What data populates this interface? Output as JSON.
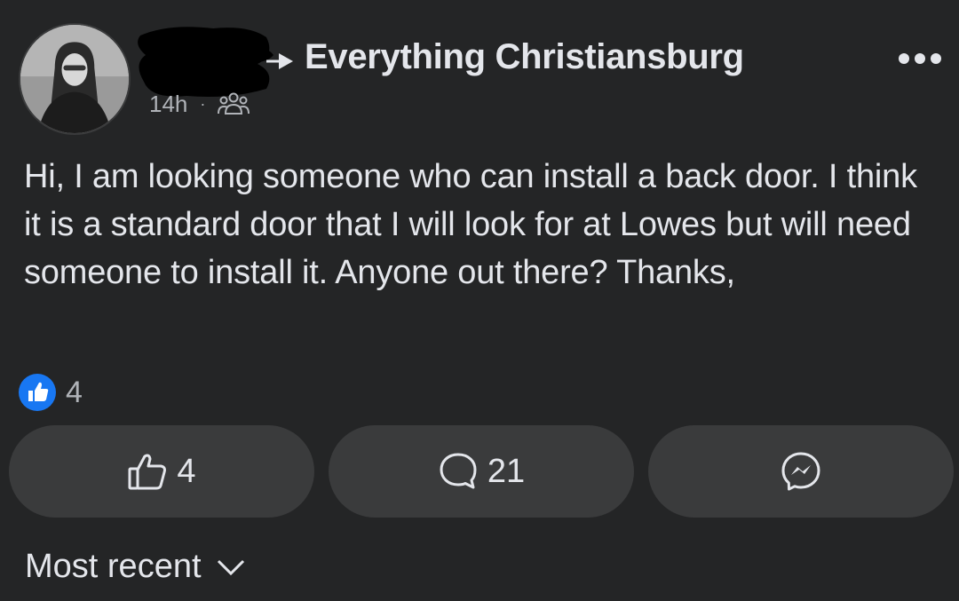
{
  "post": {
    "group_name": "Everything Christiansburg",
    "time": "14h",
    "separator": "·",
    "audience_icon": "members-icon",
    "text": "Hi, I am looking someone who can install a back door. I think it is a standard door that I will look for at Lowes but will need someone to install it. Anyone out there? Thanks,",
    "reactions": {
      "icon": "like-badge-icon",
      "count": "4"
    }
  },
  "actions": {
    "like": {
      "icon": "thumbs-up-icon",
      "label": "4"
    },
    "comment": {
      "icon": "comment-icon",
      "label": "21"
    },
    "share": {
      "icon": "messenger-icon",
      "label": ""
    }
  },
  "comments_sort": {
    "label": "Most recent",
    "icon": "chevron-down-icon"
  },
  "colors": {
    "background": "#242526",
    "button": "#3a3b3c",
    "primary_text": "#e4e6eb",
    "secondary_text": "#b0b3b8",
    "like_blue": "#1877f2"
  }
}
